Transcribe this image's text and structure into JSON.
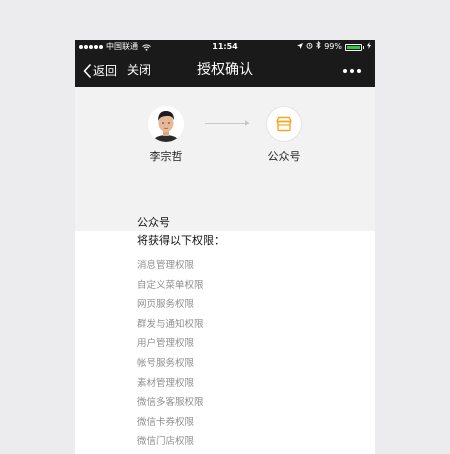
{
  "status_bar": {
    "carrier": "中国联通",
    "time": "11:54",
    "battery_percent": "99%",
    "battery_level": 0.99,
    "icons": [
      "signal-dots-icon",
      "wifi-icon",
      "location-arrow-icon",
      "alarm-icon",
      "bluetooth-icon",
      "battery-icon"
    ]
  },
  "nav": {
    "back_label": "返回",
    "close_label": "关闭",
    "title": "授权确认",
    "more_icon": "more-dots-icon"
  },
  "header": {
    "user_name": "李宗哲",
    "oa_name": "公众号",
    "user_icon": "avatar",
    "oa_icon": "store-icon",
    "arrow_icon": "arrow-right-icon"
  },
  "permissions": {
    "title": "公众号",
    "subtitle": "将获得以下权限：",
    "items": [
      "消息管理权限",
      "自定义菜单权限",
      "网页服务权限",
      "群发与通知权限",
      "用户管理权限",
      "帐号服务权限",
      "素材管理权限",
      "微信多客服权限",
      "微信卡券权限",
      "微信门店权限"
    ]
  },
  "colors": {
    "bar_background": "#1a1a1a",
    "header_background": "#f2f2f2",
    "page_background": "#ececee",
    "accent_orange": "#f5a623",
    "battery_green": "#2ecc40",
    "muted_text": "#8f8f8f"
  }
}
